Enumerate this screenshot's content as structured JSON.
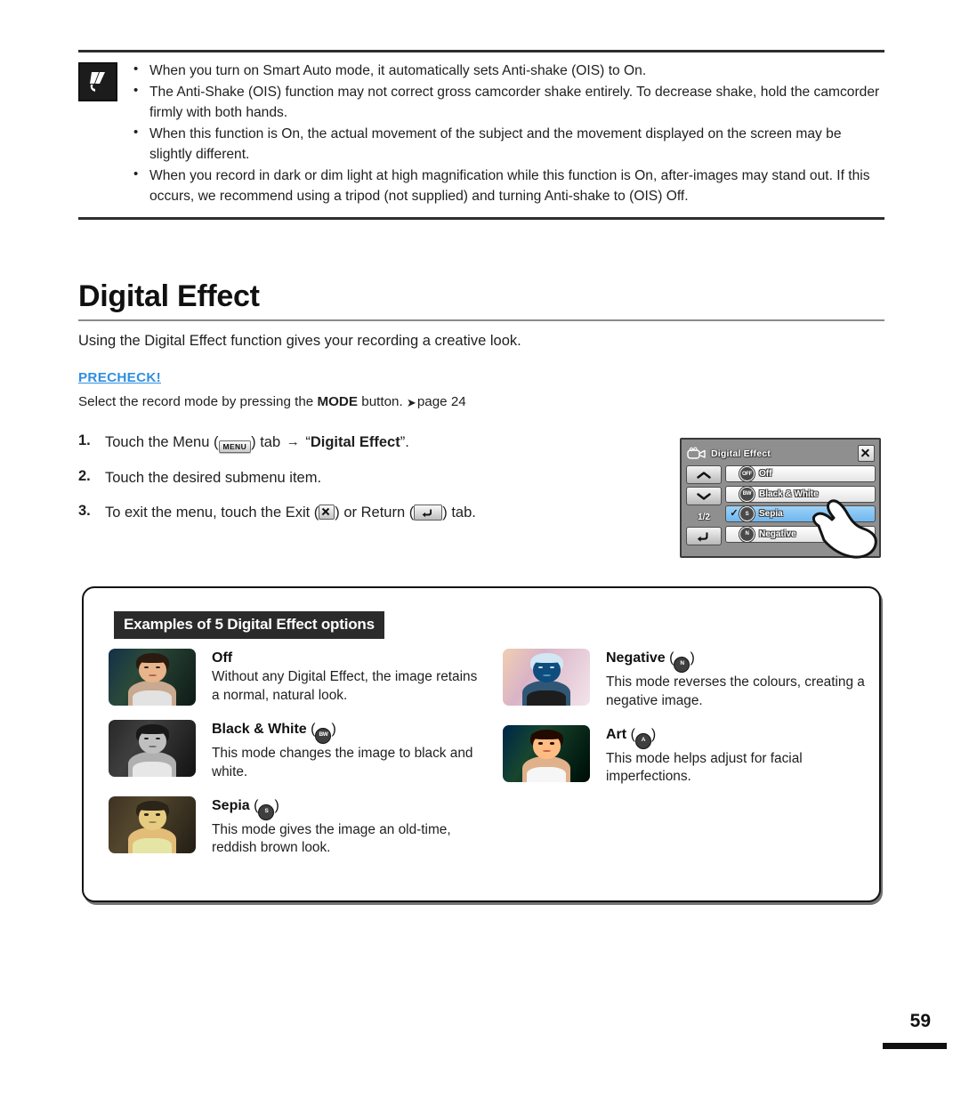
{
  "note": {
    "icon": "note-pen-icon",
    "bullets": [
      "When you turn on Smart Auto mode, it automatically sets Anti-shake (OIS) to On.",
      "The Anti-Shake (OIS) function may not correct gross camcorder shake entirely. To decrease shake, hold the camcorder firmly with both hands.",
      "When this function is On, the actual movement of the subject and the movement displayed on the screen may be slightly different.",
      "When you record in dark or dim light at high magnification while this function is On, after-images may stand out. If this occurs, we recommend using a tripod (not supplied) and turning Anti-shake to (OIS) Off."
    ]
  },
  "heading": {
    "title": "Digital Effect",
    "intro": "Using the Digital Effect function gives your recording a creative look.",
    "precheck_label": "PRECHECK!",
    "precheck_prefix": "Select the record mode by pressing the ",
    "precheck_bold": "MODE",
    "precheck_suffix": " button. ",
    "precheck_page": "page 24",
    "precheck_color": "#2f8fe0"
  },
  "steps": [
    {
      "num": "1.",
      "prefix": "Touch the Menu (",
      "key": "MENU",
      "mid": ") tab ",
      "arrow": "→",
      "quote_open": " “",
      "bold": "Digital Effect",
      "suffix": "”."
    },
    {
      "num": "2.",
      "text": "Touch the desired submenu item."
    },
    {
      "num": "3.",
      "prefix": "To exit the menu, touch the Exit (",
      "mid": ") or Return (",
      "suffix": ") tab."
    }
  ],
  "lcd": {
    "title": "Digital Effect",
    "camera_icon": "camcorder-icon",
    "close_icon": "close-x-icon",
    "page_indicator": "1/2",
    "up_icon": "chevron-up-icon",
    "down_icon": "chevron-down-icon",
    "return_icon": "return-arrow-icon",
    "items": [
      {
        "label": "Off",
        "badge": "OFF",
        "selected": false,
        "check": ""
      },
      {
        "label": "Black & White",
        "badge": "BW",
        "selected": false,
        "check": ""
      },
      {
        "label": "Sepia",
        "badge": "S",
        "selected": true,
        "check": "✓"
      },
      {
        "label": "Negative",
        "badge": "N",
        "selected": false,
        "check": ""
      }
    ],
    "hand_cursor": "pointing-hand-icon",
    "highlight_color": "#7fc0f2"
  },
  "examples": {
    "title": "Examples of 5 Digital Effect options",
    "left": [
      {
        "name": "Off",
        "badge": "",
        "desc": "Without any Digital Effect, the image retains a normal, natural look.",
        "thumb": "portrait-normal"
      },
      {
        "name": "Black & White",
        "badge": "BW",
        "desc": "This mode changes the image to black and white.",
        "thumb": "portrait-black-and-white"
      },
      {
        "name": "Sepia",
        "badge": "S",
        "desc": "This mode gives the image an old-time, reddish brown look.",
        "thumb": "portrait-sepia"
      }
    ],
    "right": [
      {
        "name": "Negative",
        "badge": "N",
        "desc": "This mode reverses the colours, creating a negative image.",
        "thumb": "portrait-negative"
      },
      {
        "name": "Art",
        "badge": "A",
        "desc": "This mode helps adjust for facial imperfections.",
        "thumb": "portrait-art"
      }
    ]
  },
  "footer": {
    "page_number": "59"
  }
}
